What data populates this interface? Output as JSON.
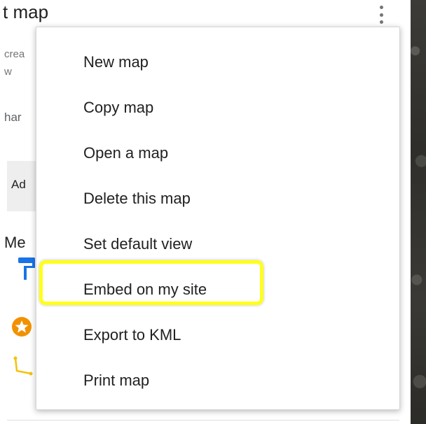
{
  "panel": {
    "title_partial": "t map",
    "description_line1_partial": "crea",
    "description_line2_partial": "w",
    "share_partial": "har",
    "add_layer_partial": "Ad",
    "layer_heading_partial": "Me"
  },
  "menu": {
    "items": [
      {
        "label": "New map"
      },
      {
        "label": "Copy map"
      },
      {
        "label": "Open a map"
      },
      {
        "label": "Delete this map"
      },
      {
        "label": "Set default view"
      },
      {
        "label": "Embed on my site"
      },
      {
        "label": "Export to KML"
      },
      {
        "label": "Print map"
      }
    ],
    "highlighted_item": "Embed on my site"
  },
  "colors": {
    "highlight_outline": "#ffff1a",
    "style_icon_blue": "#1a73e8",
    "star_badge_orange": "#f29100",
    "route_icon_yellow": "#f4c20d",
    "map_dark": "#3a3935"
  },
  "icons": {
    "more": "more-vert-icon",
    "style": "paint-roller-icon",
    "marker": "star-marker-icon",
    "route": "route-icon"
  }
}
